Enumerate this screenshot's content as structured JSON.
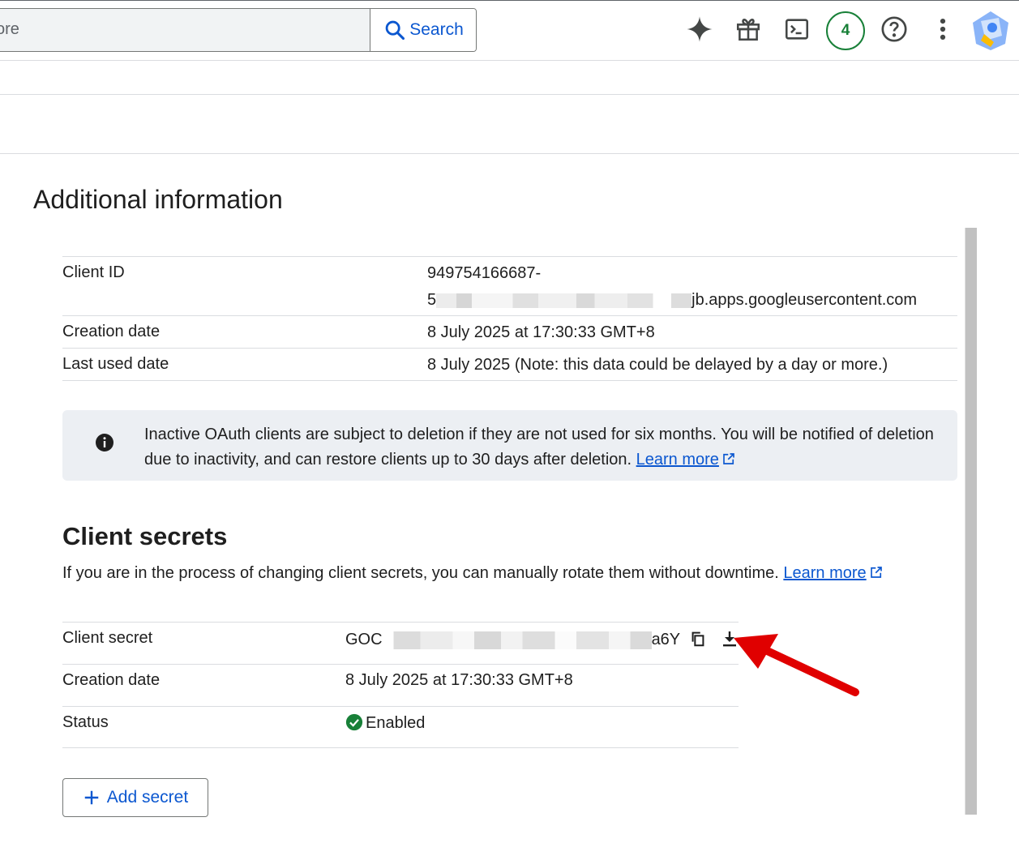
{
  "search": {
    "input_text": "ore",
    "button_label": "Search"
  },
  "header": {
    "notification_count": "4"
  },
  "main": {
    "title": "Additional information",
    "client_info": [
      {
        "label": "Client ID",
        "value_line1": "949754166687-",
        "value_prefix": "5",
        "value_suffix": "jb.apps.googleusercontent.com"
      },
      {
        "label": "Creation date",
        "value": "8 July 2025 at 17:30:33 GMT+8"
      },
      {
        "label": "Last used date",
        "value": "8 July 2025 (Note: this data could be delayed by a day or more.)"
      }
    ],
    "notice": {
      "text": "Inactive OAuth clients are subject to deletion if they are not used for six months. You will be notified of deletion due to inactivity, and can restore clients up to 30 days after deletion. ",
      "link": "Learn more"
    },
    "secrets": {
      "title": "Client secrets",
      "description": "If you are in the process of changing client secrets, you can manually rotate them without downtime. ",
      "link": "Learn more",
      "rows": [
        {
          "label": "Client secret",
          "value_prefix": "GOC",
          "value_suffix": "a6Y"
        },
        {
          "label": "Creation date",
          "value": "8 July 2025 at 17:30:33 GMT+8"
        },
        {
          "label": "Status",
          "value": "Enabled"
        }
      ],
      "add_button": "Add secret"
    }
  },
  "colors": {
    "primary": "#0b57d0",
    "success": "#188038",
    "annotation_arrow": "#e00000"
  }
}
